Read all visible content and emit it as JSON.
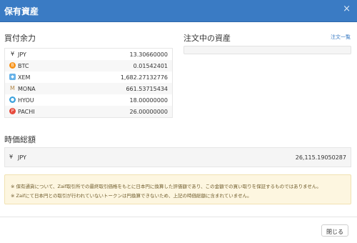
{
  "modal": {
    "title": "保有資産",
    "close_glyph": "×"
  },
  "balance": {
    "heading": "買付余力",
    "rows": [
      {
        "icon": "yen-icon",
        "glyph": "¥",
        "name": "JPY",
        "value": "13.30660000",
        "color": "#333333"
      },
      {
        "icon": "bitcoin-icon",
        "glyph": "B",
        "name": "BTC",
        "value": "0.01542401",
        "color": "#f7931a"
      },
      {
        "icon": "xem-icon",
        "glyph": "◆",
        "name": "XEM",
        "value": "1,682.27132776",
        "color": "#67b2e8"
      },
      {
        "icon": "mona-icon",
        "glyph": "M",
        "name": "MONA",
        "value": "661.53715434",
        "color": "#b38a4c"
      },
      {
        "icon": "hyou-icon",
        "glyph": "●",
        "name": "HYOU",
        "value": "18.00000000",
        "color": "#3aa0dc"
      },
      {
        "icon": "pachi-icon",
        "glyph": "P",
        "name": "PACHI",
        "value": "26.00000000",
        "color": "#e64a3c"
      }
    ]
  },
  "orders": {
    "heading": "注文中の資産",
    "link": "注文一覧"
  },
  "total": {
    "heading": "時価総額",
    "glyph": "¥",
    "name": "JPY",
    "value": "26,115.19050287"
  },
  "notice": {
    "line1": "※ 保有通貨について、Zaif取引所での最終取引価格をもとに日本円に換算した評価額であり、この金額での買い取りを保証するものではありません。",
    "line2": "※ Zaifにて日本円との取引が行われていないトークンは円換算できないため、上記の時価総額に含まれていません。"
  },
  "footer": {
    "close_label": "閉じる"
  }
}
